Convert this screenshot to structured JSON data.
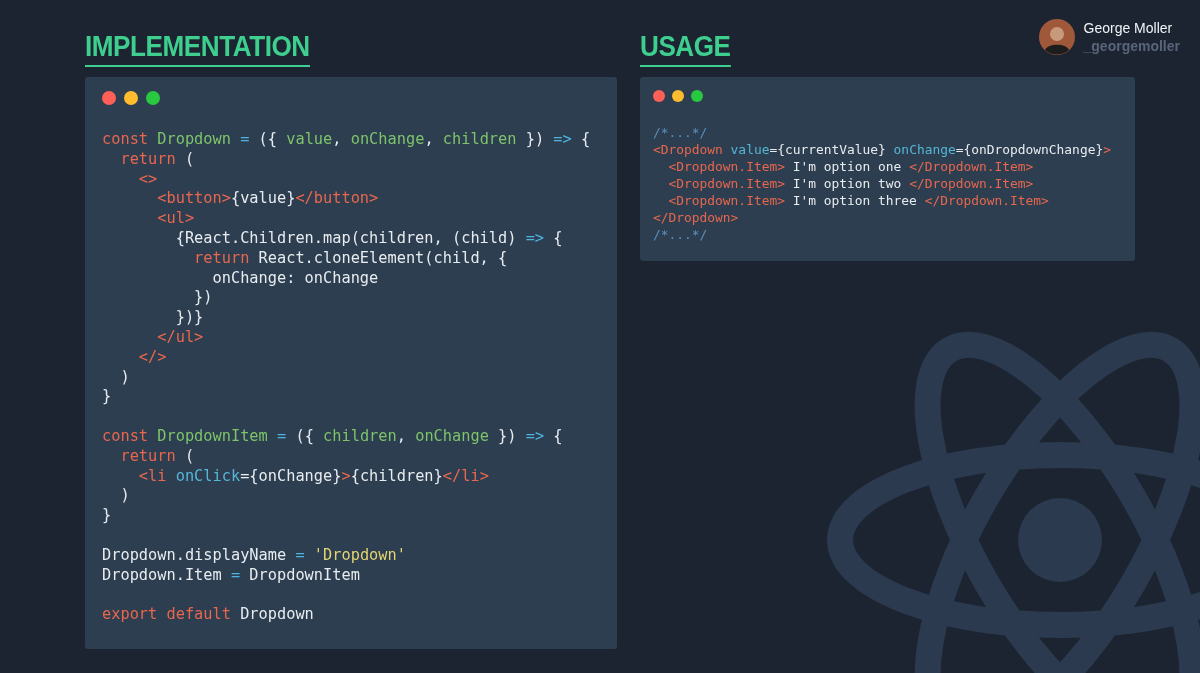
{
  "user": {
    "name": "George Moller",
    "handle": "_georgemoller"
  },
  "panels": [
    {
      "title": "IMPLEMENTATION",
      "lines": [
        {
          "tokens": [
            {
              "kind": "keyword",
              "text": "const "
            },
            {
              "kind": "name",
              "text": "Dropdown "
            },
            {
              "kind": "operator",
              "text": "= "
            },
            {
              "kind": "plain",
              "text": "({ "
            },
            {
              "kind": "name",
              "text": "value"
            },
            {
              "kind": "plain",
              "text": ", "
            },
            {
              "kind": "name",
              "text": "onChange"
            },
            {
              "kind": "plain",
              "text": ", "
            },
            {
              "kind": "name",
              "text": "children "
            },
            {
              "kind": "plain",
              "text": "}) "
            },
            {
              "kind": "operator",
              "text": "=> "
            },
            {
              "kind": "plain",
              "text": "{"
            }
          ]
        },
        {
          "tokens": [
            {
              "kind": "keyword",
              "text": "  return "
            },
            {
              "kind": "plain",
              "text": "("
            }
          ]
        },
        {
          "tokens": [
            {
              "kind": "tag",
              "text": "    <>"
            }
          ]
        },
        {
          "tokens": [
            {
              "kind": "tag",
              "text": "      <button>"
            },
            {
              "kind": "plain",
              "text": "{value}"
            },
            {
              "kind": "tag",
              "text": "</button>"
            }
          ]
        },
        {
          "tokens": [
            {
              "kind": "tag",
              "text": "      <ul>"
            }
          ]
        },
        {
          "tokens": [
            {
              "kind": "plain",
              "text": "        {React.Children.map(children, (child) "
            },
            {
              "kind": "operator",
              "text": "=> "
            },
            {
              "kind": "plain",
              "text": "{"
            }
          ]
        },
        {
          "tokens": [
            {
              "kind": "keyword",
              "text": "          return "
            },
            {
              "kind": "plain",
              "text": "React.cloneElement(child, {"
            }
          ]
        },
        {
          "tokens": [
            {
              "kind": "plain",
              "text": "            onChange: onChange"
            }
          ]
        },
        {
          "tokens": [
            {
              "kind": "plain",
              "text": "          })"
            }
          ]
        },
        {
          "tokens": [
            {
              "kind": "plain",
              "text": "        })}"
            }
          ]
        },
        {
          "tokens": [
            {
              "kind": "tag",
              "text": "      </ul>"
            }
          ]
        },
        {
          "tokens": [
            {
              "kind": "tag",
              "text": "    </>"
            }
          ]
        },
        {
          "tokens": [
            {
              "kind": "plain",
              "text": "  )"
            }
          ]
        },
        {
          "tokens": [
            {
              "kind": "plain",
              "text": "}"
            }
          ]
        },
        {
          "kind": "blank"
        },
        {
          "tokens": [
            {
              "kind": "keyword",
              "text": "const "
            },
            {
              "kind": "name",
              "text": "DropdownItem "
            },
            {
              "kind": "operator",
              "text": "= "
            },
            {
              "kind": "plain",
              "text": "({ "
            },
            {
              "kind": "name",
              "text": "children"
            },
            {
              "kind": "plain",
              "text": ", "
            },
            {
              "kind": "name",
              "text": "onChange "
            },
            {
              "kind": "plain",
              "text": "}) "
            },
            {
              "kind": "operator",
              "text": "=> "
            },
            {
              "kind": "plain",
              "text": "{"
            }
          ]
        },
        {
          "tokens": [
            {
              "kind": "keyword",
              "text": "  return "
            },
            {
              "kind": "plain",
              "text": "("
            }
          ]
        },
        {
          "tokens": [
            {
              "kind": "tag",
              "text": "    <li "
            },
            {
              "kind": "attr",
              "text": "onClick"
            },
            {
              "kind": "plain",
              "text": "={onChange}"
            },
            {
              "kind": "tag",
              "text": ">"
            },
            {
              "kind": "plain",
              "text": "{children}"
            },
            {
              "kind": "tag",
              "text": "</li>"
            }
          ]
        },
        {
          "tokens": [
            {
              "kind": "plain",
              "text": "  )"
            }
          ]
        },
        {
          "tokens": [
            {
              "kind": "plain",
              "text": "}"
            }
          ]
        },
        {
          "kind": "blank"
        },
        {
          "tokens": [
            {
              "kind": "plain",
              "text": "Dropdown.displayName "
            },
            {
              "kind": "operator",
              "text": "= "
            },
            {
              "kind": "string",
              "text": "'Dropdown'"
            }
          ]
        },
        {
          "tokens": [
            {
              "kind": "plain",
              "text": "Dropdown.Item "
            },
            {
              "kind": "operator",
              "text": "= "
            },
            {
              "kind": "plain",
              "text": "DropdownItem"
            }
          ]
        },
        {
          "kind": "blank"
        },
        {
          "tokens": [
            {
              "kind": "keyword",
              "text": "export default "
            },
            {
              "kind": "plain",
              "text": "Dropdown"
            }
          ]
        }
      ]
    },
    {
      "title": "USAGE",
      "lines": [
        {
          "tokens": [
            {
              "kind": "comment",
              "text": "/*...*/"
            }
          ]
        },
        {
          "tokens": [
            {
              "kind": "tag",
              "text": "<Dropdown "
            },
            {
              "kind": "attr",
              "text": "value"
            },
            {
              "kind": "plain",
              "text": "={currentValue} "
            },
            {
              "kind": "attr",
              "text": "onChange"
            },
            {
              "kind": "plain",
              "text": "={onDropdownChange}"
            },
            {
              "kind": "tag",
              "text": ">"
            }
          ]
        },
        {
          "tokens": [
            {
              "kind": "tag",
              "text": "  <Dropdown.Item>"
            },
            {
              "kind": "plain",
              "text": " I'm option one "
            },
            {
              "kind": "tag",
              "text": "</Dropdown.Item>"
            }
          ]
        },
        {
          "tokens": [
            {
              "kind": "tag",
              "text": "  <Dropdown.Item>"
            },
            {
              "kind": "plain",
              "text": " I'm option two "
            },
            {
              "kind": "tag",
              "text": "</Dropdown.Item>"
            }
          ]
        },
        {
          "tokens": [
            {
              "kind": "tag",
              "text": "  <Dropdown.Item>"
            },
            {
              "kind": "plain",
              "text": " I'm option three "
            },
            {
              "kind": "tag",
              "text": "</Dropdown.Item>"
            }
          ]
        },
        {
          "tokens": [
            {
              "kind": "tag",
              "text": "</Dropdown>"
            }
          ]
        },
        {
          "tokens": [
            {
              "kind": "comment",
              "text": "/*...*/"
            }
          ]
        }
      ]
    }
  ]
}
